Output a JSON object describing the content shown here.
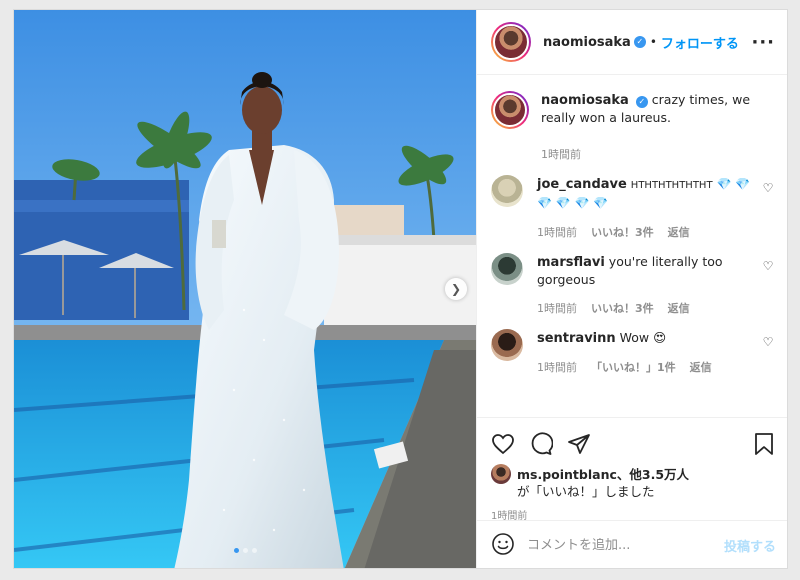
{
  "header": {
    "username": "naomiosaka",
    "separator": "•",
    "follow_label": "フォローする",
    "more_icon": "more-horizontal-icon"
  },
  "caption": {
    "username": "naomiosaka",
    "text": "crazy times, we really won a laureus.",
    "time": "1時間前"
  },
  "comments": [
    {
      "username": "joe_candave",
      "text": "HTHTHTHTHTHT",
      "emoji": "💎 💎 💎 💎 💎 💎",
      "time": "1時間前",
      "likes": "いいね！3件",
      "reply": "返信"
    },
    {
      "username": "marsflavi",
      "text": "you're literally too gorgeous",
      "time": "1時間前",
      "likes": "いいね！3件",
      "reply": "返信"
    },
    {
      "username": "sentravinn",
      "text": "Wow",
      "emoji": "😍",
      "time": "1時間前",
      "likes": "「いいね！」1件",
      "reply": "返信"
    }
  ],
  "likes": {
    "line1": "ms.pointblanc、他3.5万人",
    "line2": "が「いいね！」しました"
  },
  "post_time": "1時間前",
  "add_comment": {
    "placeholder": "コメントを追加...",
    "post_label": "投稿する"
  },
  "carousel": {
    "next_icon": "chevron-right-icon",
    "slide_count": 3,
    "active_index": 0
  },
  "colors": {
    "accent": "#0095f6",
    "verified": "#3897f0",
    "muted": "#8e8e8e"
  }
}
